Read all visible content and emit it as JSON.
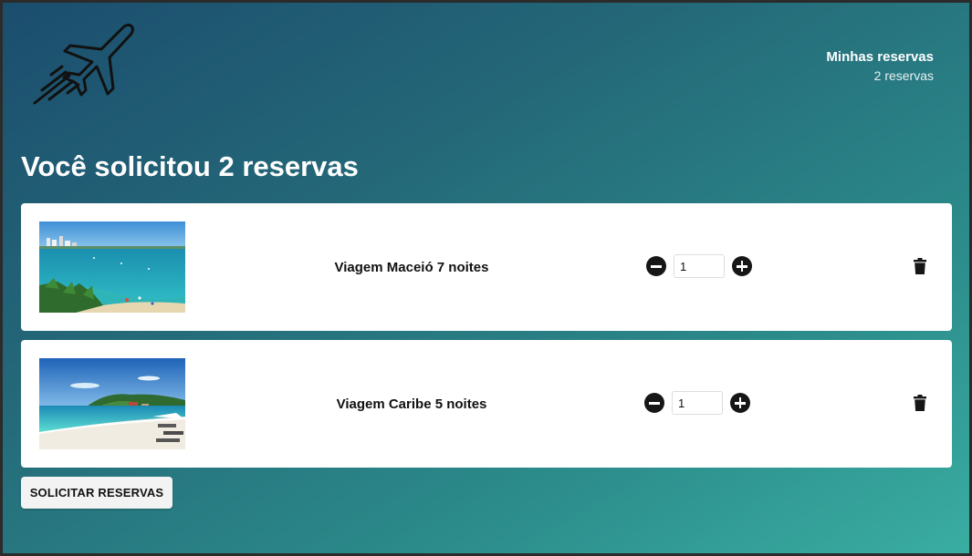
{
  "header": {
    "logo_icon": "airplane-icon",
    "reservations_title": "Minhas reservas",
    "reservations_count": "2 reservas"
  },
  "main": {
    "title": "Você solicitou 2 reservas",
    "items": [
      {
        "name": "Viagem Maceió 7 noites",
        "quantity": "1",
        "image": "maceio-beach-photo"
      },
      {
        "name": "Viagem Caribe 5 noites",
        "quantity": "1",
        "image": "caribe-beach-photo"
      }
    ],
    "submit_label": "SOLICITAR RESERVAS"
  },
  "icons": {
    "decrease": "minus-circle-icon",
    "increase": "plus-circle-icon",
    "delete": "trash-icon"
  },
  "colors": {
    "gradient_start": "#1b4d6e",
    "gradient_end": "#3aaea2",
    "card_bg": "#ffffff",
    "icon_dark": "#161616"
  }
}
